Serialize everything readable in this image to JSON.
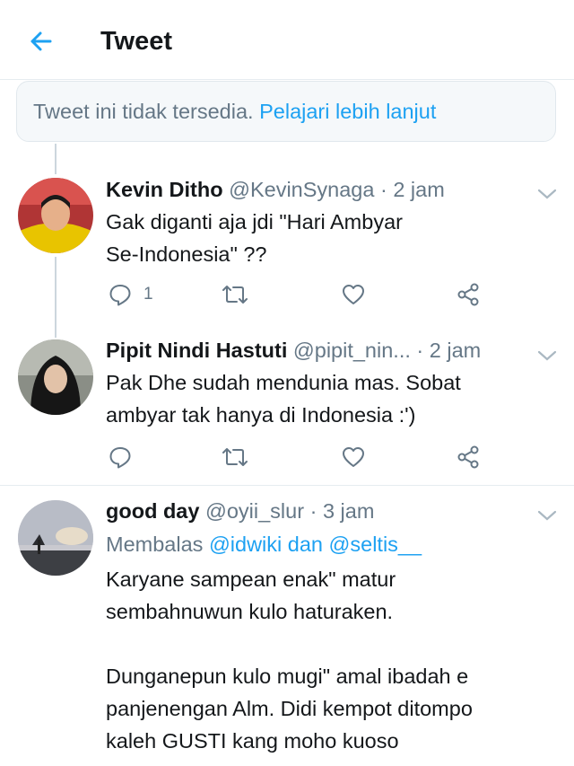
{
  "header": {
    "title": "Tweet",
    "back_icon": "arrow-left-icon",
    "accent": "#1da1f2"
  },
  "notice": {
    "text": "Tweet ini tidak tersedia.",
    "link": "Pelajari lebih lanjut"
  },
  "tweets": [
    {
      "name": "Kevin Ditho",
      "handle": "@KevinSynaga",
      "dot": "·",
      "time": "2 jam",
      "text": [
        "Gak diganti aja jdi \"Hari Ambyar",
        "Se-Indonesia\" ??"
      ],
      "reply_count": "1"
    },
    {
      "name": "Pipit Nindi Hastuti",
      "handle": "@pipit_nin...",
      "dot": "·",
      "time": "2 jam",
      "text": [
        "Pak Dhe sudah mendunia mas. Sobat",
        "ambyar tak hanya di Indonesia :')"
      ],
      "reply_count": ""
    },
    {
      "name": "good day",
      "handle": "@oyii_slur",
      "dot": "·",
      "time": "3 jam",
      "replying_prefix": "Membalas",
      "replying_mentions": "@idwiki dan @seltis__",
      "text": [
        "Karyane sampean enak\" matur",
        "sembahnuwun kulo haturaken.",
        "",
        "Dunganepun kulo mugi\" amal ibadah e",
        "panjenengan Alm. Didi kempot ditompo",
        "kaleh GUSTI kang moho kuoso"
      ]
    }
  ],
  "icons": {
    "reply": "reply-icon",
    "retweet": "retweet-icon",
    "like": "heart-icon",
    "share": "share-icon",
    "caret": "chevron-down-icon"
  }
}
